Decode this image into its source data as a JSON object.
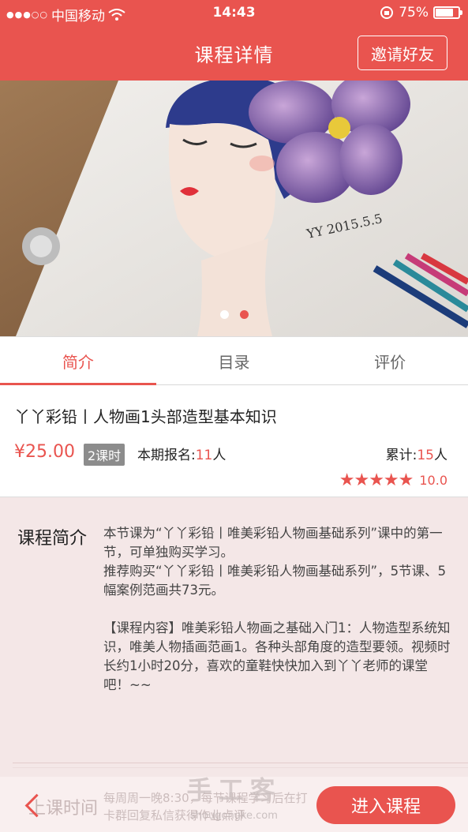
{
  "status_bar": {
    "carrier": "中国移动",
    "time": "14:43",
    "battery": "75%"
  },
  "nav": {
    "title": "课程详情",
    "invite_label": "邀请好友"
  },
  "banner": {
    "signature": "YY 2015.5.5",
    "page_count": 2,
    "active_page": 2
  },
  "tabs": [
    {
      "label": "简介",
      "active": true
    },
    {
      "label": "目录",
      "active": false
    },
    {
      "label": "评价",
      "active": false
    }
  ],
  "course": {
    "title": "丫丫彩铅丨人物画1头部造型基本知识",
    "price": "¥25.00",
    "lessons": "2课时",
    "enroll_label": "本期报名:",
    "enroll_count": "11",
    "enroll_unit": "人",
    "total_label": "累计:",
    "total_count": "15",
    "total_unit": "人",
    "stars": 5,
    "score": "10.0"
  },
  "intro": {
    "label": "课程简介",
    "text": "本节课为“丫丫彩铅丨唯美彩铅人物画基础系列”课中的第一节，可单独购买学习。\n推荐购买“丫丫彩铅丨唯美彩铅人物画基础系列”，5节课、5幅案例范画共73元。\n\n【课程内容】唯美彩铅人物画之基础入门1：人物造型系统知识，唯美人物插画范画1。各种头部角度的造型要领。视频时长约1小时20分，喜欢的童鞋快快加入到丫丫老师的课堂吧！~~"
  },
  "bottom_bar": {
    "label": "上课时间",
    "info": "每周周一晚8:30，每节课程学习后在打卡群回复私信获得作业点评",
    "enter_label": "进入课程"
  },
  "watermark": {
    "cn": "手工客",
    "en": "shougongke.com"
  },
  "colors": {
    "accent": "#e9544f"
  }
}
